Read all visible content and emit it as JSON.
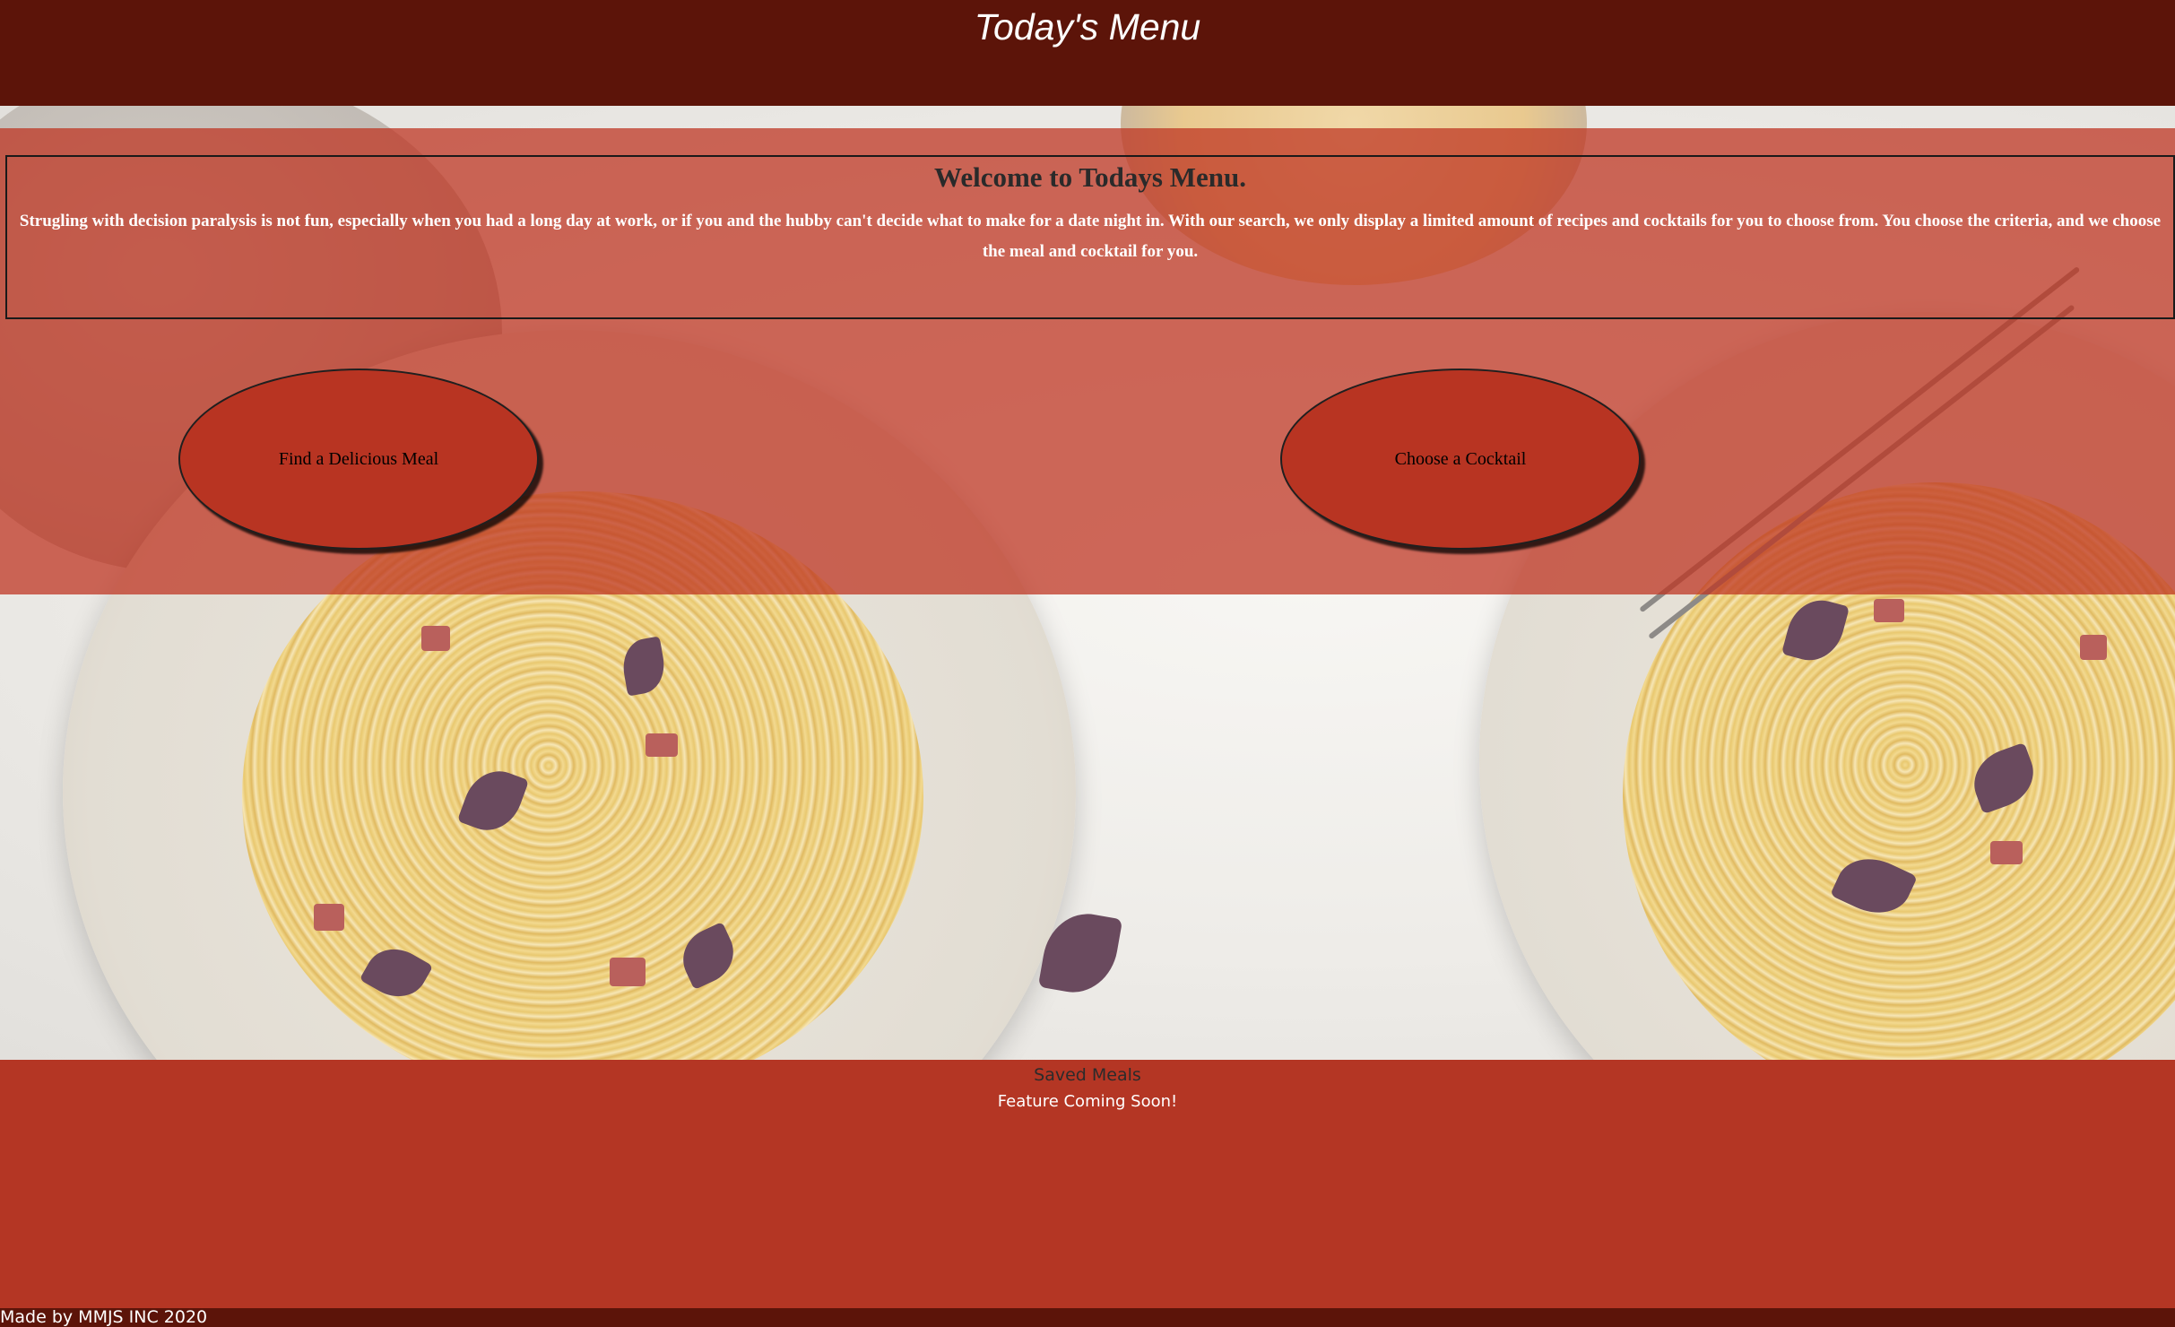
{
  "header": {
    "title": "Today's Menu"
  },
  "intro": {
    "heading": "Welcome to Todays Menu.",
    "body": "Strugling with decision paralysis is not fun, especially when you had a long day at work, or if you and the hubby can't decide what to make for a date night in. With our search, we only display a limited amount of recipes and cocktails for you to choose from. You choose the criteria, and we choose the meal and cocktail for you."
  },
  "actions": {
    "meal_label": "Find a Delicious Meal",
    "cocktail_label": "Choose a Cocktail"
  },
  "saved": {
    "heading": "Saved Meals",
    "note": "Feature Coming Soon!"
  },
  "footer": {
    "credit": "Made by MMJS INC 2020"
  },
  "colors": {
    "header_bg": "#5c1409",
    "accent_red": "#b43624",
    "button_red": "#b83422"
  }
}
